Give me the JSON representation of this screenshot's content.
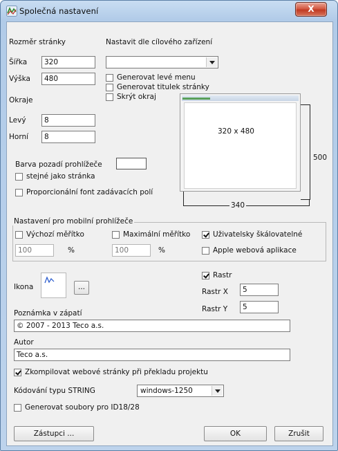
{
  "window": {
    "title": "Společná nastavení",
    "close_label": "X"
  },
  "page_size": {
    "label": "Rozměr stránky",
    "width_label": "Šířka",
    "width_value": "320",
    "height_label": "Výška",
    "height_value": "480"
  },
  "device": {
    "label": "Nastavit dle cílového zařízení",
    "selected": "",
    "gen_left_menu": "Generovat levé menu",
    "gen_page_title": "Generovat titulek stránky",
    "hide_border": "Skrýt okraj"
  },
  "margins": {
    "label": "Okraje",
    "left_label": "Levý",
    "left_value": "8",
    "top_label": "Horní",
    "top_value": "8"
  },
  "preview": {
    "size_text": "320 x 480",
    "height_dim": "500",
    "width_dim": "340"
  },
  "background": {
    "label": "Barva pozadí prohlížeče",
    "same_as_page": "stejné jako stránka",
    "proportional_font": "Proporcionální font zadávacích polí",
    "swatch_color": "#ffffff"
  },
  "mobile": {
    "group_label": "Nastavení pro mobilní prohlížeče",
    "default_scale": "Výchozí měřítko",
    "default_scale_value": "100",
    "max_scale": "Maximální měřítko",
    "max_scale_value": "100",
    "percent": "%",
    "user_scalable": "Uživatelsky škálovatelné",
    "apple_webapp": "Apple webová aplikace"
  },
  "icon": {
    "label": "Ikona",
    "browse_label": "..."
  },
  "grid": {
    "label": "Rastr",
    "x_label": "Rastr X",
    "x_value": "5",
    "y_label": "Rastr Y",
    "y_value": "5"
  },
  "footer_note": {
    "label": "Poznámka v zápatí",
    "value": "© 2007 - 2013 Teco a.s."
  },
  "author": {
    "label": "Autor",
    "value": "Teco a.s."
  },
  "compile_web": "Zkompilovat webové stránky při překladu projektu",
  "string_encoding": {
    "label": "Kódování typu STRING",
    "value": "windows-1250"
  },
  "gen_files": "Generovat soubory pro ID18/28",
  "buttons": {
    "substitutes": "Zástupci ...",
    "ok": "OK",
    "cancel": "Zrušit"
  }
}
